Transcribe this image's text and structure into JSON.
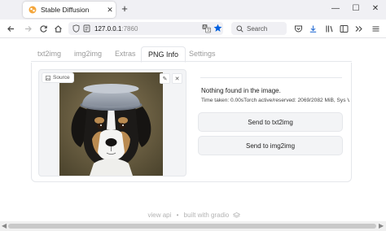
{
  "browser": {
    "tab_title": "Stable Diffusion",
    "url_host": "127.0.0.1",
    "url_port": ":7860",
    "search_placeholder": "Search",
    "win_minimize": "—",
    "win_maximize": "☐",
    "win_close": "✕",
    "tab_close": "✕",
    "new_tab": "+"
  },
  "app": {
    "tabs": [
      {
        "label": "txt2img"
      },
      {
        "label": "img2img"
      },
      {
        "label": "Extras"
      },
      {
        "label": "PNG Info"
      },
      {
        "label": "Settings"
      }
    ],
    "active_tab": "PNG Info",
    "source_label": "Source",
    "edit_icon": "✎",
    "close_icon": "✕",
    "output_title": "Nothing found in the image.",
    "output_sub": "Time taken: 0.00sTorch active/reserved: 2069/2082 MiB, Sys VRAM: 10240/",
    "send_txt2img": "Send to txt2img",
    "send_img2img": "Send to img2img",
    "footer_api": "view api",
    "footer_sep": "•",
    "footer_built": "built with gradio"
  },
  "colors": {
    "firefox_star": "#0060df",
    "chrome_bg": "#f0f0f4"
  }
}
